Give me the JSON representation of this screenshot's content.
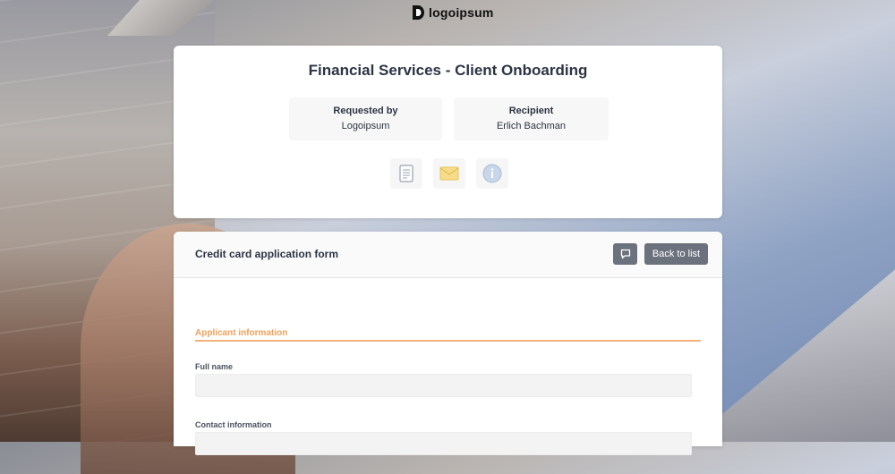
{
  "brand": {
    "name": "logoipsum"
  },
  "header_card": {
    "title": "Financial Services - Client Onboarding",
    "requested_by_label": "Requested by",
    "requested_by_value": "Logoipsum",
    "recipient_label": "Recipient",
    "recipient_value": "Erlich Bachman",
    "icons": [
      "document-icon",
      "envelope-icon",
      "info-icon"
    ]
  },
  "form": {
    "title": "Credit card application form",
    "back_label": "Back to list",
    "section_title": "Applicant information",
    "fields": [
      {
        "label": "Full name",
        "value": ""
      },
      {
        "label": "Contact information",
        "value": ""
      }
    ]
  },
  "colors": {
    "accent": "#f0a05a",
    "button": "#6c727d",
    "text": "#2c3444"
  }
}
